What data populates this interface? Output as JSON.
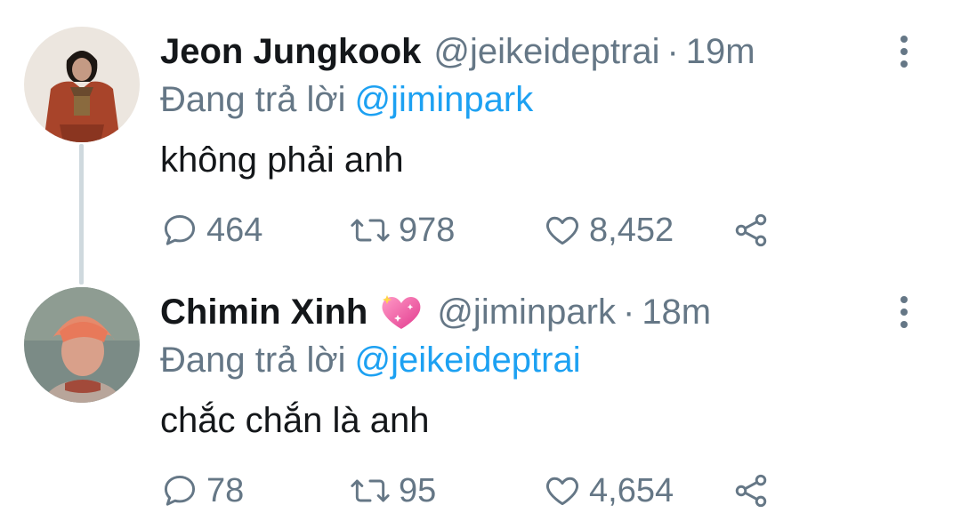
{
  "tweets": [
    {
      "display_name": "Jeon Jungkook",
      "handle": "@jeikeideptrai",
      "separator": "·",
      "time": "19m",
      "replying_prefix": "Đang trả lời",
      "replying_to": "@jiminpark",
      "text": "không phải anh",
      "replies": "464",
      "retweets": "978",
      "likes": "8,452",
      "avatar_colors": [
        "#ece6df",
        "#a8442a",
        "#3a2a1e"
      ]
    },
    {
      "display_name": "Chimin Xinh",
      "name_emoji": "sparkling-heart-icon",
      "handle": "@jiminpark",
      "separator": "·",
      "time": "18m",
      "replying_prefix": "Đang trả lời",
      "replying_to": "@jeikeideptrai",
      "text": "chắc chắn là anh",
      "replies": "78",
      "retweets": "95",
      "likes": "4,654",
      "avatar_colors": [
        "#7b8b86",
        "#e58a6c",
        "#b8a59a"
      ]
    }
  ],
  "colors": {
    "text": "#14171a",
    "secondary": "#657786",
    "link": "#1da1f2",
    "thread_line": "#cfd9de"
  }
}
